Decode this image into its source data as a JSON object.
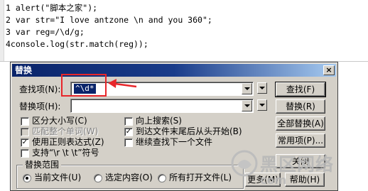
{
  "editor": {
    "lines": [
      "1 alert(\"脚本之家\");",
      "2 var str=\"I love antzone \\n and you 360\";",
      "3 var reg=/\\d/g;",
      "4console.log(str.match(reg));"
    ]
  },
  "dialog": {
    "title": "替换",
    "close_label": "×",
    "find_label": "查找项(N):",
    "find_value": "^\\d*",
    "replace_label": "替换项(H):",
    "replace_value": "",
    "options": {
      "match_case": {
        "label": "区分大小写(C)",
        "checked": false
      },
      "whole_word": {
        "label": "匹配整个单词(W)",
        "checked": false,
        "disabled": true
      },
      "regex": {
        "label": "使用正则表达式(Z)",
        "checked": true
      },
      "escape": {
        "label": "支持“\\r \\t \\t”符号",
        "checked": false
      },
      "search_up": {
        "label": "向上搜索(S)",
        "checked": false
      },
      "wrap": {
        "label": "到达文件末尾后从头开始(B)",
        "checked": true
      },
      "continue_next": {
        "label": "继续查找下一个文件",
        "checked": false
      }
    },
    "scope": {
      "title": "替换范围",
      "items": [
        {
          "label": "当前文件(U)",
          "selected": true
        },
        {
          "label": "选定内容(O)",
          "selected": false
        },
        {
          "label": "所有打开文件(L)",
          "selected": false
        }
      ]
    },
    "buttons": {
      "find": "查找(F)",
      "replace": "替换(R)",
      "replace_all": "全部替换(A)",
      "common": "常用项(P)...",
      "close": "关闭",
      "more": "更多(M)",
      "help": "帮助(H)"
    }
  },
  "watermark": {
    "text": "黑区网络",
    "sub": "com"
  }
}
